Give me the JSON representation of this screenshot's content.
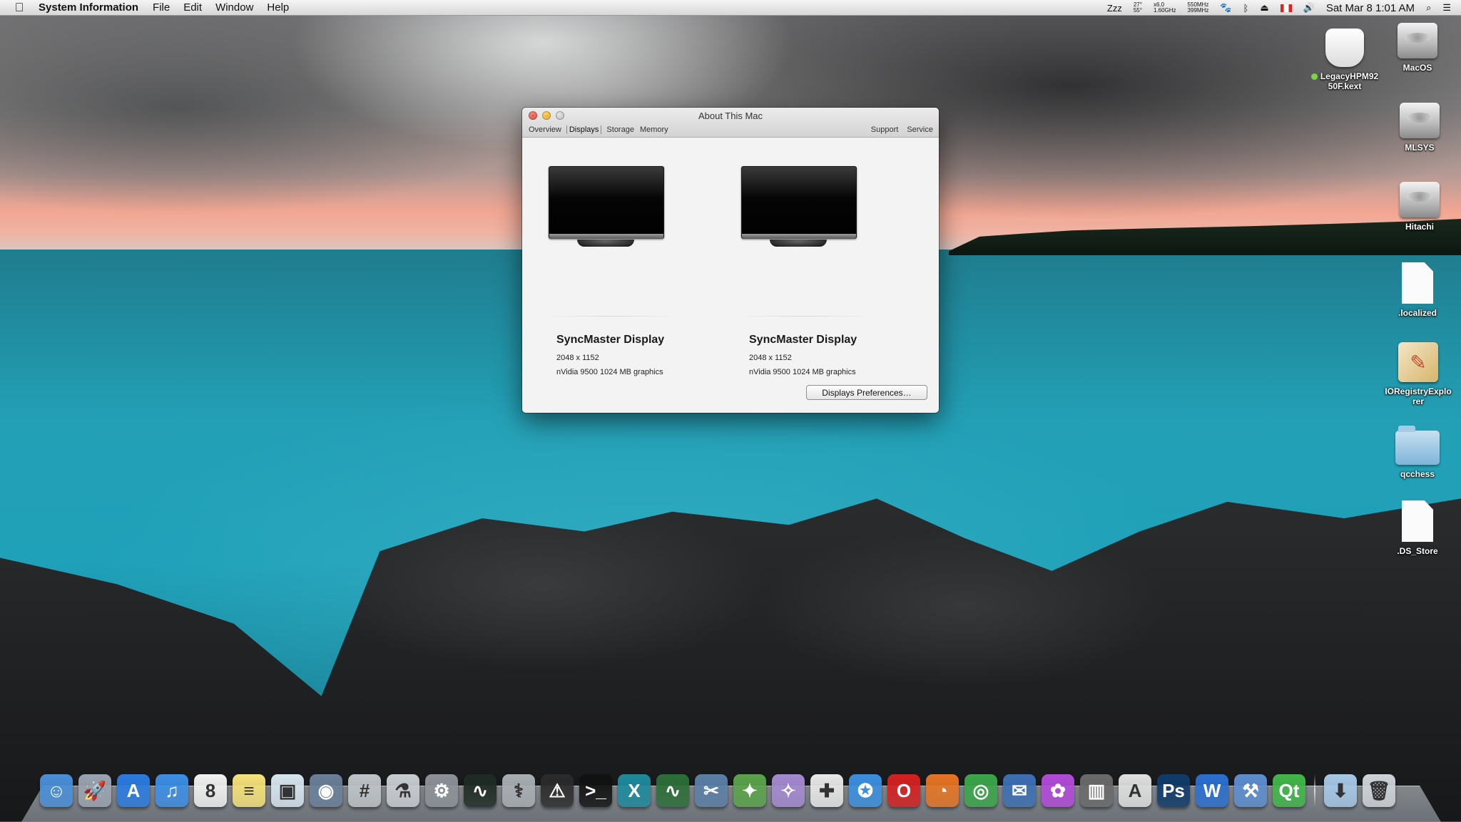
{
  "menubar": {
    "app_name": "System Information",
    "items": [
      "File",
      "Edit",
      "Window",
      "Help"
    ],
    "status": {
      "sleep": "Zzz",
      "temp_top": "27°",
      "temp_bottom": "55°",
      "cpu_multiplier": "x6.0",
      "cpu_freq": "1.60GHz",
      "mem_top": "550MHz",
      "mem_bottom": "399MHz",
      "datetime": "Sat Mar 8  1:01 AM"
    }
  },
  "desktop_icons": [
    {
      "label": "LegacyHPM9250F.kext",
      "label_line1": "LegacyHPM92",
      "label_line2": "50F.kext",
      "kind": "kext",
      "tag_color": "#7bd34a"
    },
    {
      "label": "MacOS",
      "kind": "drive"
    },
    {
      "label": "MLSYS",
      "kind": "drive"
    },
    {
      "label": "Hitachi",
      "kind": "drive"
    },
    {
      "label": ".localized",
      "kind": "document"
    },
    {
      "label": "IORegistryExplorer",
      "label_line1": "IORegistryExplo",
      "label_line2": "rer",
      "kind": "app"
    },
    {
      "label": "qcchess",
      "kind": "folder"
    },
    {
      "label": ".DS_Store",
      "kind": "document"
    }
  ],
  "window": {
    "title": "About This Mac",
    "tabs": [
      "Overview",
      "Displays",
      "Storage",
      "Memory"
    ],
    "active_tab": "Displays",
    "right_links": [
      "Support",
      "Service"
    ],
    "displays": [
      {
        "name": "SyncMaster Display",
        "resolution": "2048 x 1152",
        "graphics": "nVidia 9500 1024 MB graphics"
      },
      {
        "name": "SyncMaster Display",
        "resolution": "2048 x 1152",
        "graphics": "nVidia 9500 1024 MB graphics"
      }
    ],
    "prefs_button": "Displays Preferences…"
  },
  "dock": {
    "apps": [
      {
        "name": "finder-icon",
        "glyph": "☺",
        "color": "#4a8fd8"
      },
      {
        "name": "launchpad-icon",
        "glyph": "🚀",
        "color": "#9aa4b0"
      },
      {
        "name": "app-store-icon",
        "glyph": "A",
        "color": "#2b7be0"
      },
      {
        "name": "itunes-icon",
        "glyph": "♫",
        "color": "#3c8ee6"
      },
      {
        "name": "calendar-icon",
        "glyph": "8",
        "color": "#f2f2f2"
      },
      {
        "name": "stickies-icon",
        "glyph": "≡",
        "color": "#f5e27a"
      },
      {
        "name": "preview-icon",
        "glyph": "▣",
        "color": "#d7e5ef"
      },
      {
        "name": "photo-booth-icon",
        "glyph": "◉",
        "color": "#6a7f99"
      },
      {
        "name": "calculator-icon",
        "glyph": "#",
        "color": "#bfc4c9"
      },
      {
        "name": "directory-utility-icon",
        "glyph": "⚗",
        "color": "#c8cdd2"
      },
      {
        "name": "system-preferences-icon",
        "glyph": "⚙",
        "color": "#8d9298"
      },
      {
        "name": "activity-monitor-icon",
        "glyph": "∿",
        "color": "#1e2b24"
      },
      {
        "name": "disk-utility-icon",
        "glyph": "⚕",
        "color": "#a9aeb3"
      },
      {
        "name": "console-icon",
        "glyph": "⚠",
        "color": "#2b2b2b"
      },
      {
        "name": "terminal-icon",
        "glyph": ">_",
        "color": "#111111"
      },
      {
        "name": "x11-icon",
        "glyph": "X",
        "color": "#1d8a9c"
      },
      {
        "name": "istat-icon",
        "glyph": "∿",
        "color": "#2c6e38"
      },
      {
        "name": "utilities-icon",
        "glyph": "✂",
        "color": "#5b7fa6"
      },
      {
        "name": "wizard-green-icon",
        "glyph": "✦",
        "color": "#5aa34a"
      },
      {
        "name": "wizard-purple-icon",
        "glyph": "✧",
        "color": "#a48ad0"
      },
      {
        "name": "kext-utility-icon",
        "glyph": "✚",
        "color": "#e8e8e8"
      },
      {
        "name": "safari-icon",
        "glyph": "✪",
        "color": "#3b8fe0"
      },
      {
        "name": "opera-icon",
        "glyph": "O",
        "color": "#d42020"
      },
      {
        "name": "firefox-icon",
        "glyph": "◔",
        "color": "#e57423"
      },
      {
        "name": "chrome-icon",
        "glyph": "◎",
        "color": "#3aa64a"
      },
      {
        "name": "thunderbird-icon",
        "glyph": "✉",
        "color": "#3c6fb4"
      },
      {
        "name": "flower-app-icon",
        "glyph": "✿",
        "color": "#b24ad9"
      },
      {
        "name": "archive-utility-icon",
        "glyph": "▥",
        "color": "#6a6a6a"
      },
      {
        "name": "acrobat-icon",
        "glyph": "A",
        "color": "#e0e0e0"
      },
      {
        "name": "photoshop-icon",
        "glyph": "Ps",
        "color": "#0f3b6a"
      },
      {
        "name": "word-icon",
        "glyph": "W",
        "color": "#2a6fd1"
      },
      {
        "name": "xcode-icon",
        "glyph": "⚒",
        "color": "#5d8ecf"
      },
      {
        "name": "qt-creator-icon",
        "glyph": "Qt",
        "color": "#41b649"
      }
    ],
    "trailing": [
      {
        "name": "downloads-folder-icon",
        "glyph": "⬇",
        "color": "#a6c8e6"
      },
      {
        "name": "trash-icon",
        "glyph": "🗑",
        "color": "#cfd4d9"
      }
    ]
  }
}
